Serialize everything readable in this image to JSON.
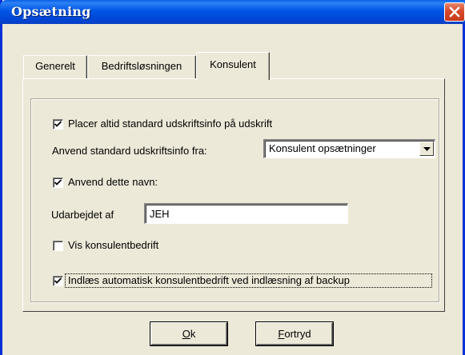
{
  "window": {
    "title": "Opsætning"
  },
  "tabs": [
    {
      "label": "Generelt",
      "active": false
    },
    {
      "label": "Bedriftsløsningen",
      "active": false
    },
    {
      "label": "Konsulent",
      "active": true
    }
  ],
  "konsulent": {
    "placer_checkbox": {
      "label": "Placer altid standard udskriftsinfo på udskrift",
      "checked": true
    },
    "anvend_fra_label": "Anvend standard udskriftsinfo fra:",
    "anvend_fra_select": {
      "value": "Konsulent opsætninger"
    },
    "anvend_navn_checkbox": {
      "label": "Anvend dette navn:",
      "checked": true
    },
    "udarbejdet_label": "Udarbejdet af",
    "udarbejdet_value": "JEH",
    "vis_konsulent_checkbox": {
      "label": "Vis konsulentbedrift",
      "checked": false
    },
    "indlaes_checkbox": {
      "label": "Indlæs automatisk konsulentbedrift ved indlæsning af backup",
      "checked": true
    }
  },
  "buttons": {
    "ok": {
      "mnemonic": "O",
      "rest": "k"
    },
    "cancel": {
      "mnemonic": "F",
      "rest": "ortryd"
    }
  }
}
